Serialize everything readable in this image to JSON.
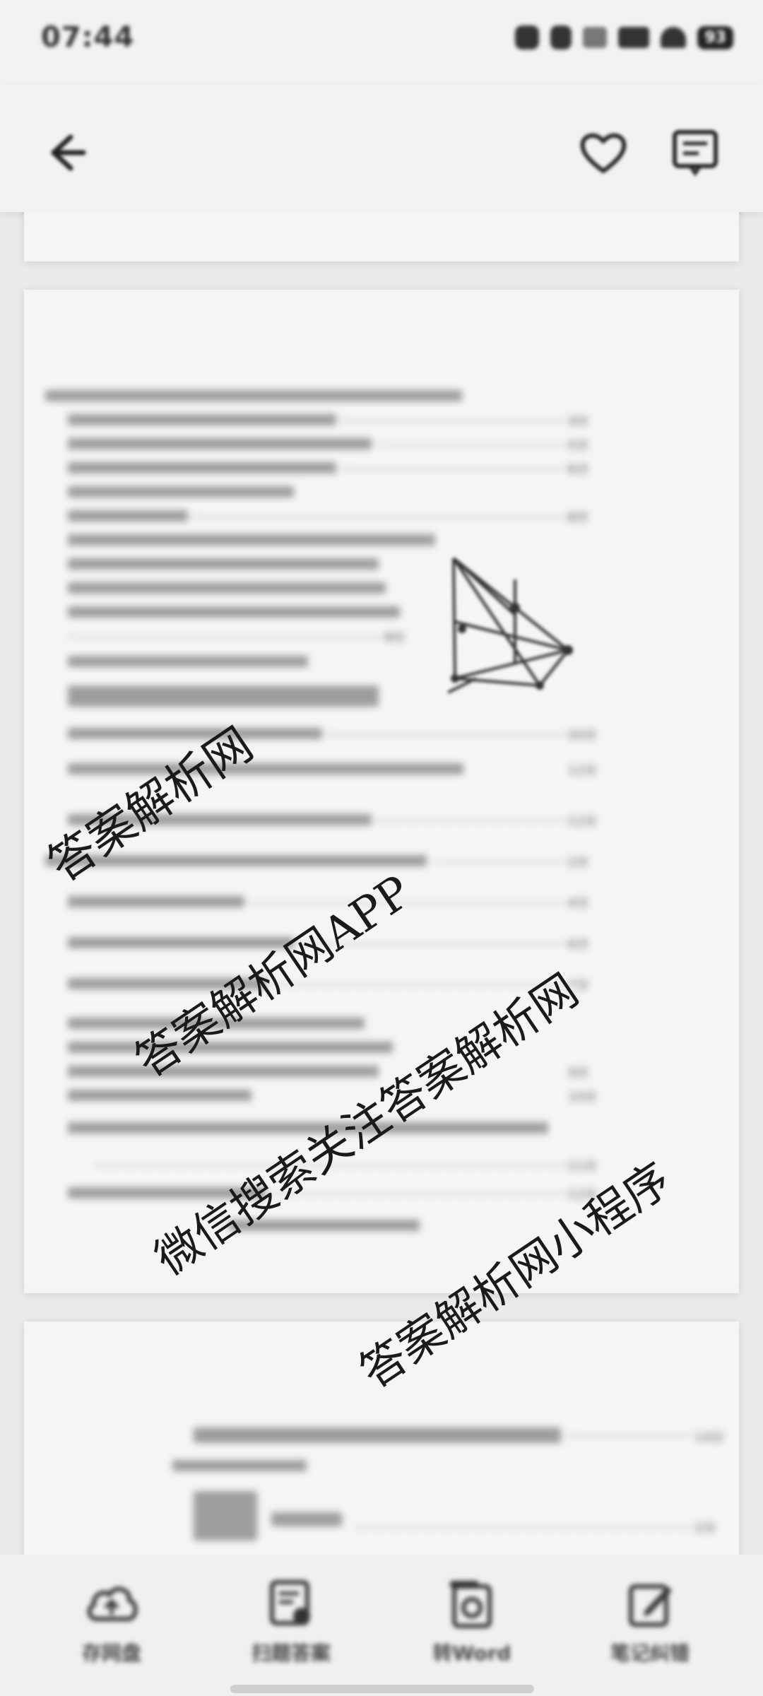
{
  "status_bar": {
    "time": "07:44",
    "battery": "93"
  },
  "app_bar": {
    "back_icon": "arrow-left-icon",
    "favorite_icon": "heart-icon",
    "note_icon": "note-icon"
  },
  "watermarks": [
    "答案解析网",
    "答案解析网APP",
    "微信搜索关注答案解析网",
    "答案解析网小程序"
  ],
  "toolbar": {
    "items": [
      {
        "label": "存网盘",
        "icon": "cloud-upload-icon"
      },
      {
        "label": "扫题答案",
        "icon": "scan-doc-icon"
      },
      {
        "label": "转Word",
        "icon": "word-convert-icon"
      },
      {
        "label": "笔记纠错",
        "icon": "edit-icon"
      }
    ]
  }
}
